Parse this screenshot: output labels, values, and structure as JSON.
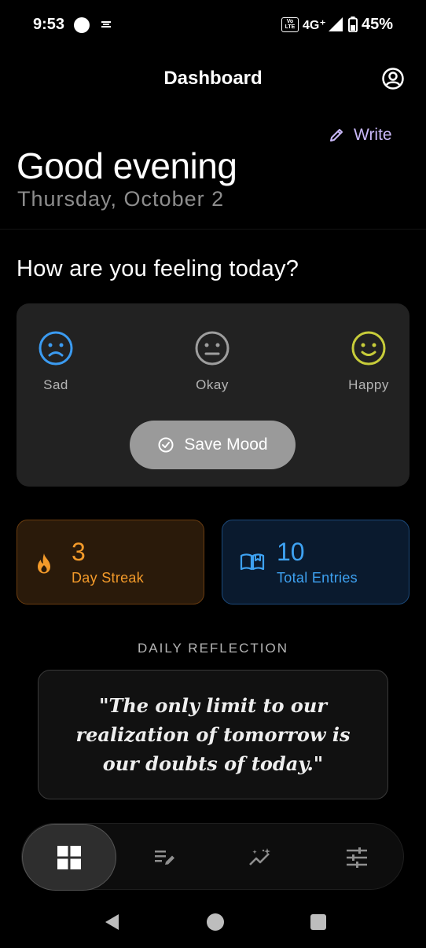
{
  "status_bar": {
    "time": "9:53",
    "network": "4G⁺",
    "volte": "Vo LTE",
    "battery": "45%"
  },
  "header": {
    "title": "Dashboard",
    "profile_icon": "account-circle-icon"
  },
  "write_button": {
    "label": "Write",
    "icon": "pencil-icon"
  },
  "greeting": "Good evening",
  "date": "Thursday, October 2",
  "mood": {
    "question": "How are you feeling today?",
    "options": [
      {
        "label": "Sad",
        "icon": "sad-face-icon",
        "color": "#3b9bf1"
      },
      {
        "label": "Okay",
        "icon": "neutral-face-icon",
        "color": "#9e9e9e"
      },
      {
        "label": "Happy",
        "icon": "happy-face-icon",
        "color": "#c7cc3a"
      }
    ],
    "save_label": "Save Mood"
  },
  "stats": {
    "streak": {
      "value": "3",
      "label": "Day Streak",
      "icon": "fire-icon",
      "color": "#f39a2a"
    },
    "entries": {
      "value": "10",
      "label": "Total Entries",
      "icon": "open-book-icon",
      "color": "#3ea2f2"
    }
  },
  "reflection": {
    "heading": "DAILY REFLECTION",
    "quote": "\"The only limit to our realization of tomorrow is our doubts of today.\""
  },
  "bottom_nav": [
    {
      "name": "dashboard",
      "icon": "grid-icon",
      "active": true
    },
    {
      "name": "entries",
      "icon": "edit-list-icon",
      "active": false
    },
    {
      "name": "insights",
      "icon": "sparkle-trend-icon",
      "active": false
    },
    {
      "name": "settings",
      "icon": "sliders-icon",
      "active": false
    }
  ]
}
